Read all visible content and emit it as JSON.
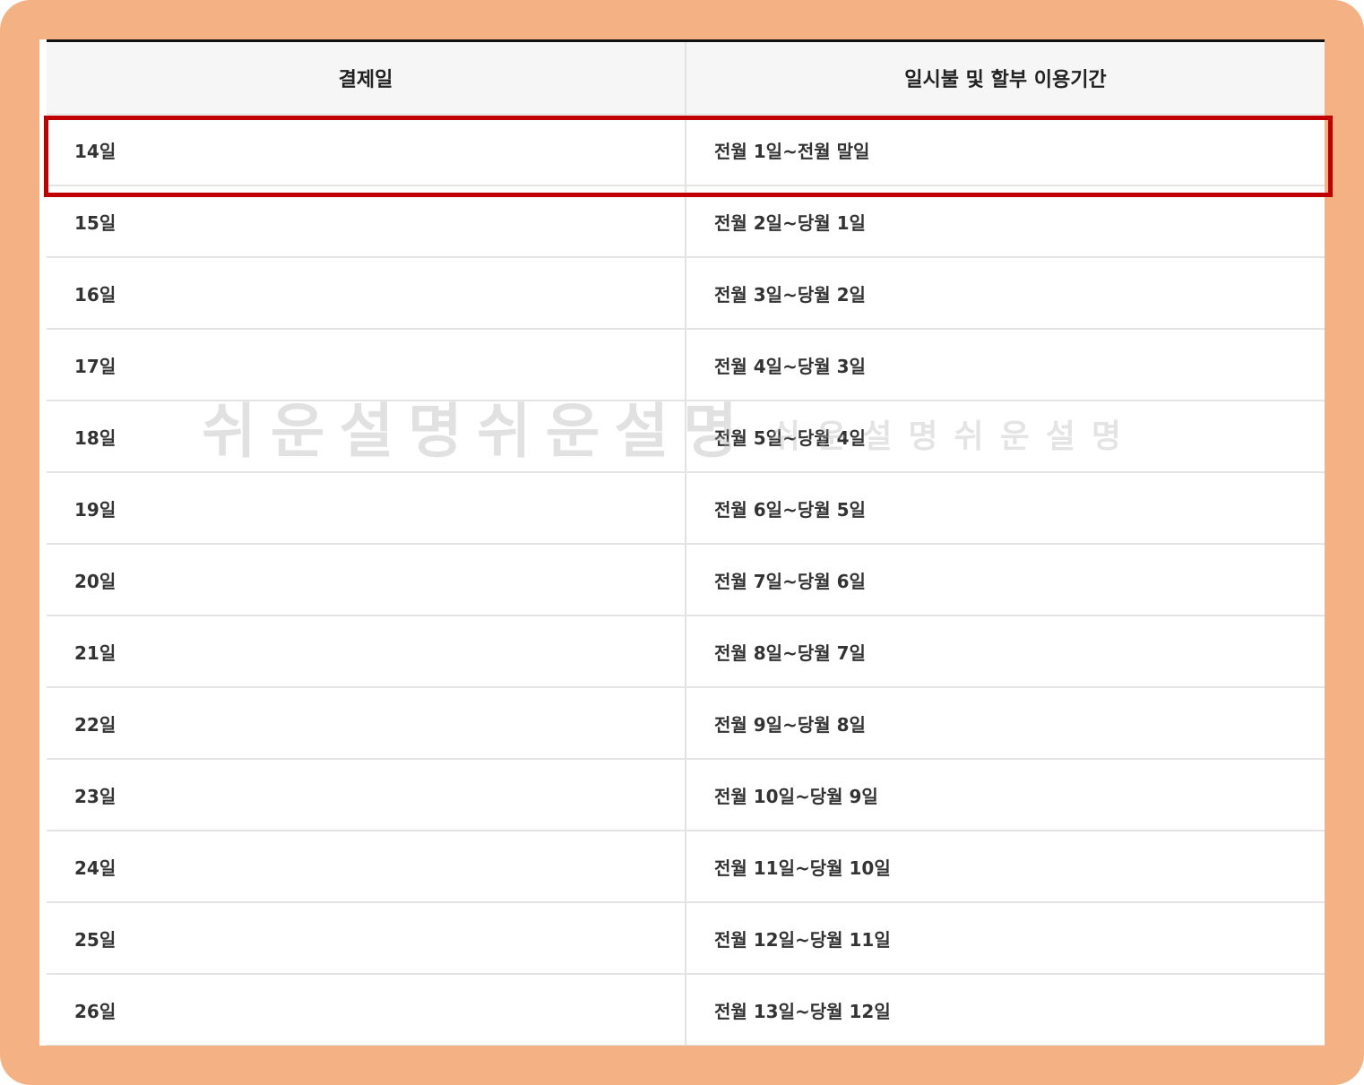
{
  "table": {
    "headers": [
      "결제일",
      "일시불 및 할부 이용기간"
    ],
    "rows": [
      [
        "14일",
        "전월 1일~전월 말일"
      ],
      [
        "15일",
        "전월 2일~당월 1일"
      ],
      [
        "16일",
        "전월 3일~당월 2일"
      ],
      [
        "17일",
        "전월 4일~당월 3일"
      ],
      [
        "18일",
        "전월 5일~당월 4일"
      ],
      [
        "19일",
        "전월 6일~당월 5일"
      ],
      [
        "20일",
        "전월 7일~당월 6일"
      ],
      [
        "21일",
        "전월 8일~당월 7일"
      ],
      [
        "22일",
        "전월 9일~당월 8일"
      ],
      [
        "23일",
        "전월 10일~당월 9일"
      ],
      [
        "24일",
        "전월 11일~당월 10일"
      ],
      [
        "25일",
        "전월 12일~당월 11일"
      ],
      [
        "26일",
        "전월 13일~당월 12일"
      ]
    ],
    "highlighted_row": 0
  },
  "watermark": {
    "large": "쉬운설명쉬운설명",
    "small": "쉬운설명쉬운설명"
  },
  "colors": {
    "frame": "#f4b183",
    "highlight": "#c00000",
    "header_bg": "#f6f6f6"
  }
}
